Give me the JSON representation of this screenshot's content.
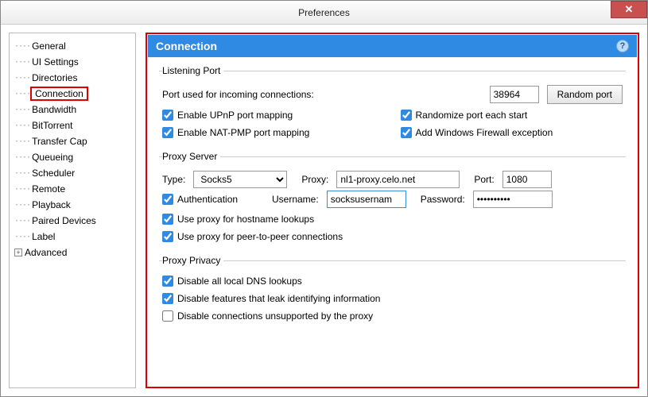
{
  "window": {
    "title": "Preferences"
  },
  "sidebar": {
    "items": [
      {
        "label": "General"
      },
      {
        "label": "UI Settings"
      },
      {
        "label": "Directories"
      },
      {
        "label": "Connection",
        "selected": true
      },
      {
        "label": "Bandwidth"
      },
      {
        "label": "BitTorrent"
      },
      {
        "label": "Transfer Cap"
      },
      {
        "label": "Queueing"
      },
      {
        "label": "Scheduler"
      },
      {
        "label": "Remote"
      },
      {
        "label": "Playback"
      },
      {
        "label": "Paired Devices"
      },
      {
        "label": "Label"
      }
    ],
    "advanced_label": "Advanced"
  },
  "panel": {
    "title": "Connection",
    "listening": {
      "legend": "Listening Port",
      "port_label": "Port used for incoming connections:",
      "port_value": "38964",
      "random_button": "Random port",
      "upnp_label": "Enable UPnP port mapping",
      "natpmp_label": "Enable NAT-PMP port mapping",
      "randomize_label": "Randomize port each start",
      "firewall_label": "Add Windows Firewall exception"
    },
    "proxy": {
      "legend": "Proxy Server",
      "type_label": "Type:",
      "type_value": "Socks5",
      "proxy_label": "Proxy:",
      "proxy_value": "nl1-proxy.celo.net",
      "port_label": "Port:",
      "port_value": "1080",
      "auth_label": "Authentication",
      "username_label": "Username:",
      "username_value": "socksusernam",
      "password_label": "Password:",
      "password_value": "••••••••••",
      "hostname_label": "Use proxy for hostname lookups",
      "p2p_label": "Use proxy for peer-to-peer connections"
    },
    "privacy": {
      "legend": "Proxy Privacy",
      "dns_label": "Disable all local DNS lookups",
      "leak_label": "Disable features that leak identifying information",
      "unsupported_label": "Disable connections unsupported by the proxy"
    }
  }
}
